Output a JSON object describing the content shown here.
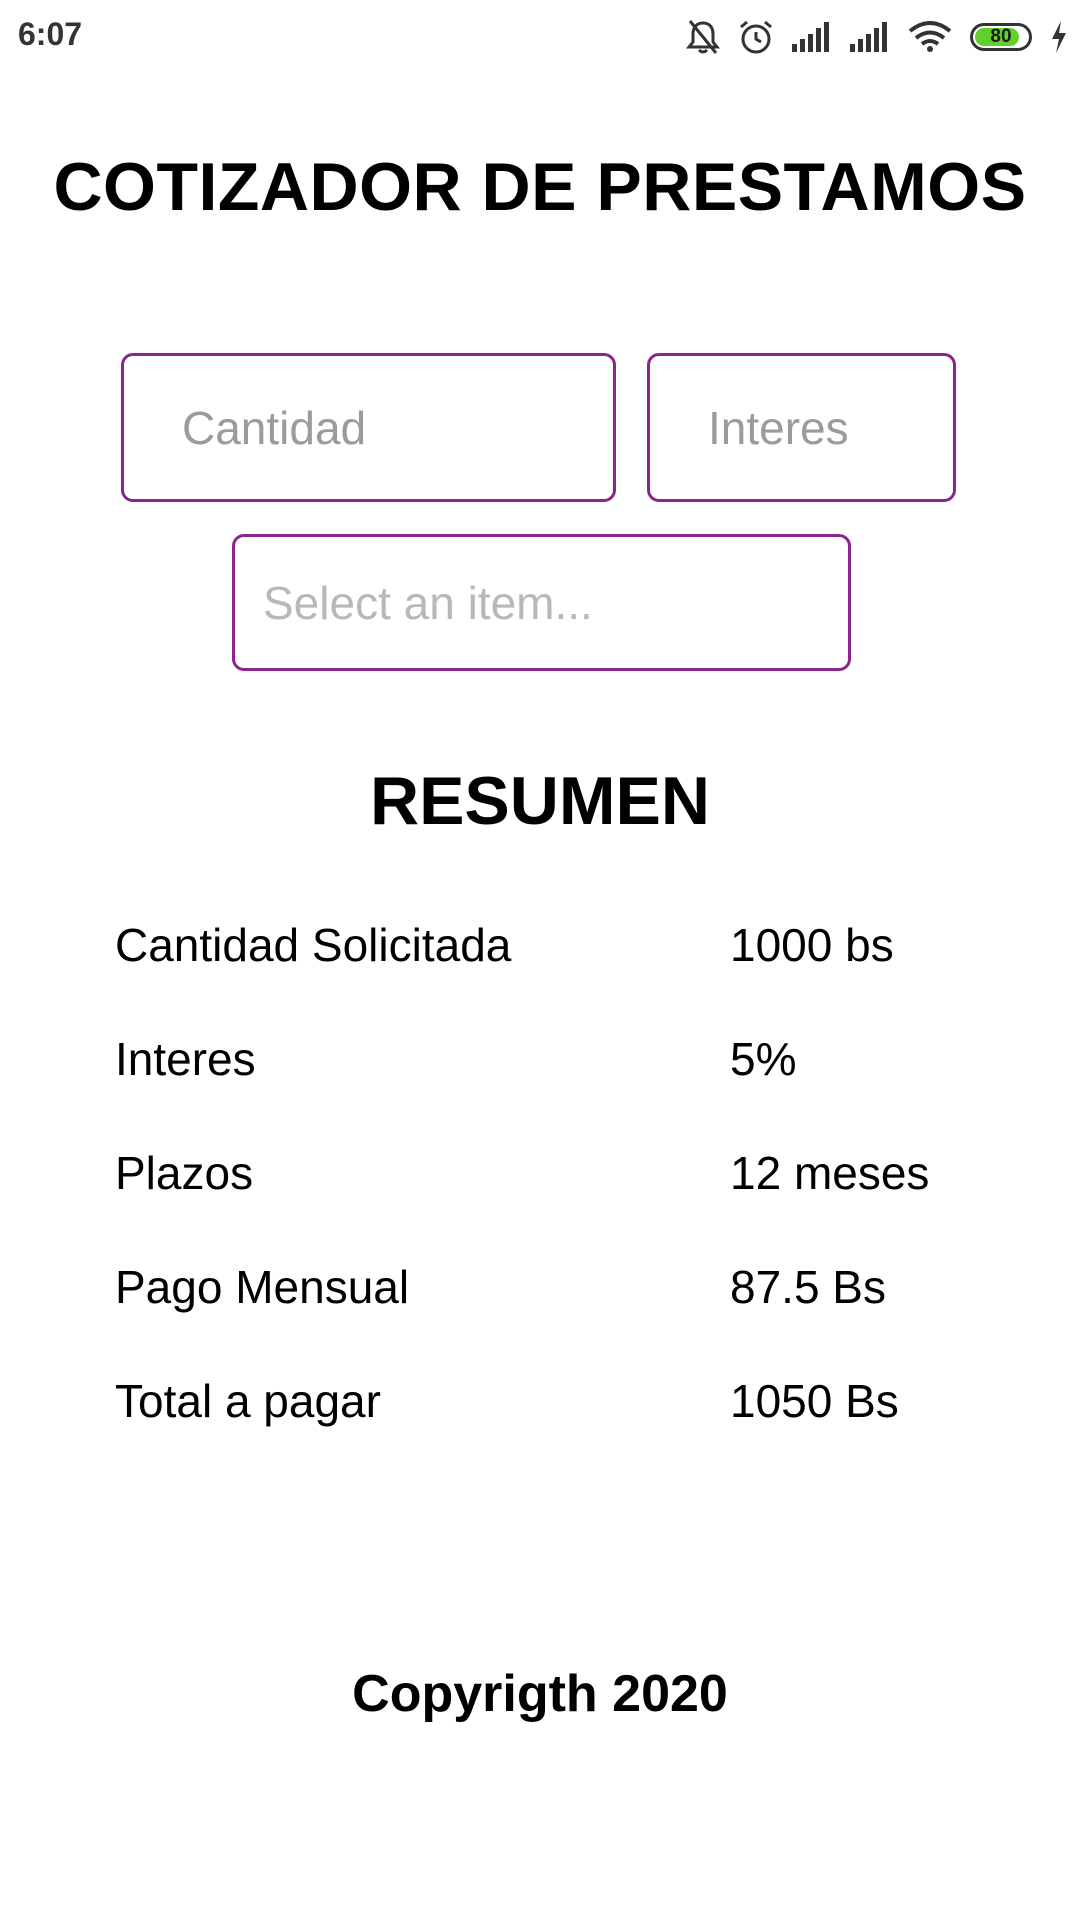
{
  "status_bar": {
    "time": "6:07",
    "battery_level": "80",
    "icons": [
      "notifications-off-icon",
      "alarm-icon",
      "signal-icon",
      "signal-icon",
      "wifi-icon",
      "battery-icon",
      "charging-icon"
    ],
    "battery_color": "#5fd12a"
  },
  "app": {
    "title": "COTIZADOR DE PRESTAMOS",
    "accent_color": "#8a2590"
  },
  "form": {
    "cantidad_placeholder": "Cantidad",
    "interes_placeholder": "Interes",
    "select_placeholder": "Select an item..."
  },
  "summary": {
    "title": "RESUMEN",
    "rows": [
      {
        "label": "Cantidad Solicitada",
        "value": "1000 bs"
      },
      {
        "label": "Interes",
        "value": "5%"
      },
      {
        "label": "Plazos",
        "value": "12 meses"
      },
      {
        "label": "Pago Mensual",
        "value": "87.5 Bs"
      },
      {
        "label": "Total a pagar",
        "value": "1050 Bs"
      }
    ]
  },
  "footer": {
    "copyright": "Copyrigth 2020"
  }
}
